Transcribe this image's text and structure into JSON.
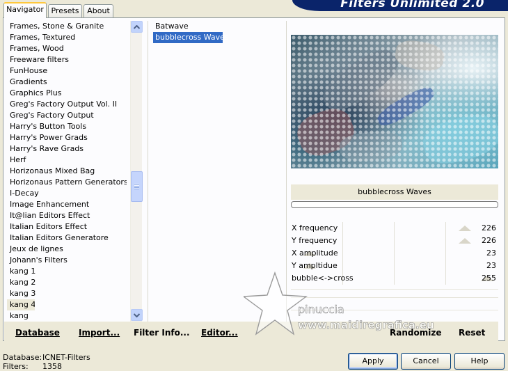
{
  "tabs": [
    {
      "label": "Navigator",
      "active": true
    },
    {
      "label": "Presets",
      "active": false
    },
    {
      "label": "About",
      "active": false
    }
  ],
  "banner": {
    "title": "Filters Unlimited 2.0",
    "bg_color": "#0a246a"
  },
  "categories": {
    "items": [
      "Frames, Stone & Granite",
      "Frames, Textured",
      "Frames, Wood",
      "Freeware filters",
      "FunHouse",
      "Gradients",
      "Graphics Plus",
      "Greg's Factory Output Vol. II",
      "Greg's Factory Output",
      "Harry's Button Tools",
      "Harry's Power Grads",
      "Harry's Rave Grads",
      "Herf",
      "Horizonaus Mixed Bag",
      "Horizonaus Pattern Generators",
      "I-Decay",
      "Image Enhancement",
      "It@lian Editors Effect",
      "Italian Editors Effect",
      "Italian Editors Generatore",
      "Jeux de lignes",
      "Johann's Filters",
      "kang 1",
      "kang 2",
      "kang 3",
      "kang 4",
      "kang"
    ],
    "selected": "kang 4"
  },
  "filters": {
    "items": [
      "Batwave",
      "bubblecross Waves"
    ],
    "selected": "bubblecross Waves",
    "selection_color": "#316ac5"
  },
  "preview": {
    "filter_name": "bubblecross Waves"
  },
  "params": [
    {
      "label": "X frequency",
      "value": "226",
      "level": 226
    },
    {
      "label": "Y frequency",
      "value": "226",
      "level": 226
    },
    {
      "label": "X amplitude",
      "value": "23",
      "level": 23
    },
    {
      "label": "Y ampltidue",
      "value": "23",
      "level": 23
    },
    {
      "label": "bubble<->cross",
      "value": "255",
      "level": 255
    }
  ],
  "bottom_buttons": {
    "database": "Database",
    "import": "Import...",
    "filter_info": "Filter Info...",
    "editor": "Editor...",
    "randomize": "Randomize",
    "reset": "Reset"
  },
  "status": {
    "database_label": "Database:",
    "database_value": "ICNET-Filters",
    "filters_label": "Filters:",
    "filters_value": "1358"
  },
  "dialog_buttons": {
    "apply": "Apply",
    "cancel": "Cancel",
    "help": "Help"
  },
  "watermark": {
    "line1": "pinuccia",
    "line2": "www.maidiregrafica.eu"
  }
}
